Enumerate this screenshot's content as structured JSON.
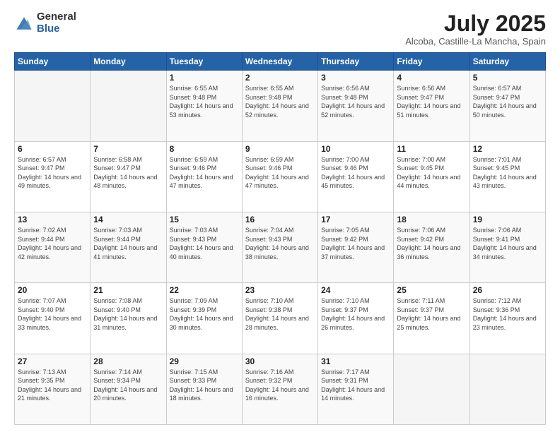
{
  "logo": {
    "general": "General",
    "blue": "Blue"
  },
  "title": "July 2025",
  "location": "Alcoba, Castille-La Mancha, Spain",
  "days_of_week": [
    "Sunday",
    "Monday",
    "Tuesday",
    "Wednesday",
    "Thursday",
    "Friday",
    "Saturday"
  ],
  "weeks": [
    [
      {
        "day": "",
        "info": ""
      },
      {
        "day": "",
        "info": ""
      },
      {
        "day": "1",
        "info": "Sunrise: 6:55 AM\nSunset: 9:48 PM\nDaylight: 14 hours and 53 minutes."
      },
      {
        "day": "2",
        "info": "Sunrise: 6:55 AM\nSunset: 9:48 PM\nDaylight: 14 hours and 52 minutes."
      },
      {
        "day": "3",
        "info": "Sunrise: 6:56 AM\nSunset: 9:48 PM\nDaylight: 14 hours and 52 minutes."
      },
      {
        "day": "4",
        "info": "Sunrise: 6:56 AM\nSunset: 9:47 PM\nDaylight: 14 hours and 51 minutes."
      },
      {
        "day": "5",
        "info": "Sunrise: 6:57 AM\nSunset: 9:47 PM\nDaylight: 14 hours and 50 minutes."
      }
    ],
    [
      {
        "day": "6",
        "info": "Sunrise: 6:57 AM\nSunset: 9:47 PM\nDaylight: 14 hours and 49 minutes."
      },
      {
        "day": "7",
        "info": "Sunrise: 6:58 AM\nSunset: 9:47 PM\nDaylight: 14 hours and 48 minutes."
      },
      {
        "day": "8",
        "info": "Sunrise: 6:59 AM\nSunset: 9:46 PM\nDaylight: 14 hours and 47 minutes."
      },
      {
        "day": "9",
        "info": "Sunrise: 6:59 AM\nSunset: 9:46 PM\nDaylight: 14 hours and 47 minutes."
      },
      {
        "day": "10",
        "info": "Sunrise: 7:00 AM\nSunset: 9:46 PM\nDaylight: 14 hours and 45 minutes."
      },
      {
        "day": "11",
        "info": "Sunrise: 7:00 AM\nSunset: 9:45 PM\nDaylight: 14 hours and 44 minutes."
      },
      {
        "day": "12",
        "info": "Sunrise: 7:01 AM\nSunset: 9:45 PM\nDaylight: 14 hours and 43 minutes."
      }
    ],
    [
      {
        "day": "13",
        "info": "Sunrise: 7:02 AM\nSunset: 9:44 PM\nDaylight: 14 hours and 42 minutes."
      },
      {
        "day": "14",
        "info": "Sunrise: 7:03 AM\nSunset: 9:44 PM\nDaylight: 14 hours and 41 minutes."
      },
      {
        "day": "15",
        "info": "Sunrise: 7:03 AM\nSunset: 9:43 PM\nDaylight: 14 hours and 40 minutes."
      },
      {
        "day": "16",
        "info": "Sunrise: 7:04 AM\nSunset: 9:43 PM\nDaylight: 14 hours and 38 minutes."
      },
      {
        "day": "17",
        "info": "Sunrise: 7:05 AM\nSunset: 9:42 PM\nDaylight: 14 hours and 37 minutes."
      },
      {
        "day": "18",
        "info": "Sunrise: 7:06 AM\nSunset: 9:42 PM\nDaylight: 14 hours and 36 minutes."
      },
      {
        "day": "19",
        "info": "Sunrise: 7:06 AM\nSunset: 9:41 PM\nDaylight: 14 hours and 34 minutes."
      }
    ],
    [
      {
        "day": "20",
        "info": "Sunrise: 7:07 AM\nSunset: 9:40 PM\nDaylight: 14 hours and 33 minutes."
      },
      {
        "day": "21",
        "info": "Sunrise: 7:08 AM\nSunset: 9:40 PM\nDaylight: 14 hours and 31 minutes."
      },
      {
        "day": "22",
        "info": "Sunrise: 7:09 AM\nSunset: 9:39 PM\nDaylight: 14 hours and 30 minutes."
      },
      {
        "day": "23",
        "info": "Sunrise: 7:10 AM\nSunset: 9:38 PM\nDaylight: 14 hours and 28 minutes."
      },
      {
        "day": "24",
        "info": "Sunrise: 7:10 AM\nSunset: 9:37 PM\nDaylight: 14 hours and 26 minutes."
      },
      {
        "day": "25",
        "info": "Sunrise: 7:11 AM\nSunset: 9:37 PM\nDaylight: 14 hours and 25 minutes."
      },
      {
        "day": "26",
        "info": "Sunrise: 7:12 AM\nSunset: 9:36 PM\nDaylight: 14 hours and 23 minutes."
      }
    ],
    [
      {
        "day": "27",
        "info": "Sunrise: 7:13 AM\nSunset: 9:35 PM\nDaylight: 14 hours and 21 minutes."
      },
      {
        "day": "28",
        "info": "Sunrise: 7:14 AM\nSunset: 9:34 PM\nDaylight: 14 hours and 20 minutes."
      },
      {
        "day": "29",
        "info": "Sunrise: 7:15 AM\nSunset: 9:33 PM\nDaylight: 14 hours and 18 minutes."
      },
      {
        "day": "30",
        "info": "Sunrise: 7:16 AM\nSunset: 9:32 PM\nDaylight: 14 hours and 16 minutes."
      },
      {
        "day": "31",
        "info": "Sunrise: 7:17 AM\nSunset: 9:31 PM\nDaylight: 14 hours and 14 minutes."
      },
      {
        "day": "",
        "info": ""
      },
      {
        "day": "",
        "info": ""
      }
    ]
  ]
}
